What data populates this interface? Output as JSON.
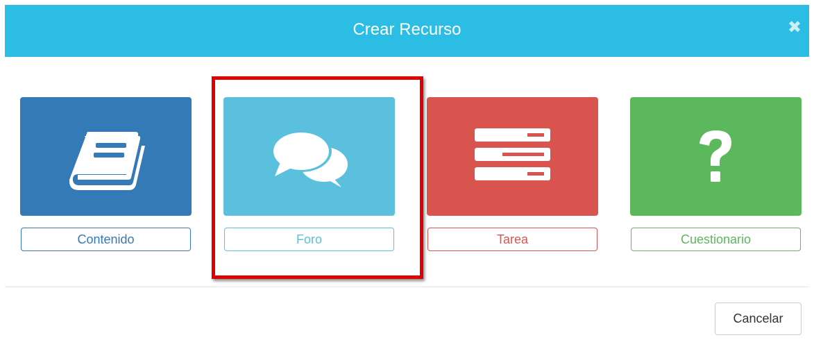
{
  "modal": {
    "title": "Crear Recurso",
    "close_icon": "close-icon",
    "cancel_label": "Cancelar"
  },
  "resources": [
    {
      "label": "Contenido",
      "icon": "book-icon",
      "color": "#337ab7"
    },
    {
      "label": "Foro",
      "icon": "comments-icon",
      "color": "#5bc0de"
    },
    {
      "label": "Tarea",
      "icon": "list-icon",
      "color": "#d9534f"
    },
    {
      "label": "Cuestionario",
      "icon": "question-icon",
      "color": "#5cb85c"
    }
  ],
  "header_color": "#2bbde3",
  "highlight_color": "#e00000"
}
